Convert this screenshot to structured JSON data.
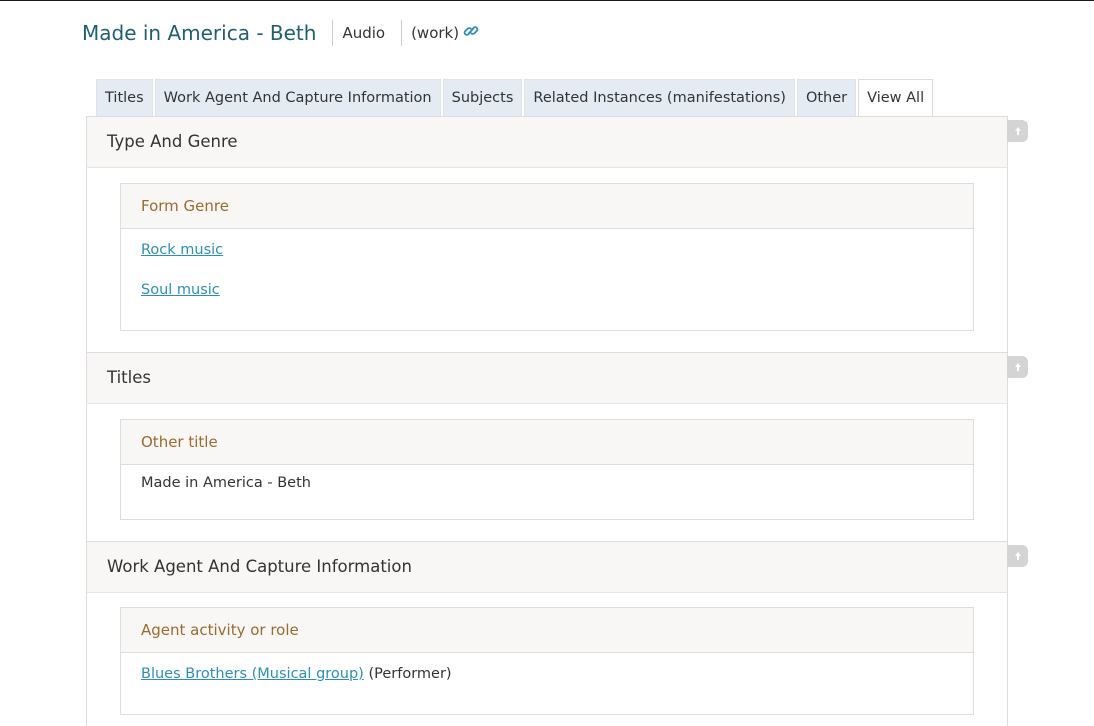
{
  "header": {
    "title": "Made in America - Beth",
    "type": "Audio",
    "kind": "(work)",
    "link_icon": "link-icon"
  },
  "tabs": [
    {
      "label": "Titles"
    },
    {
      "label": "Work Agent And Capture Information"
    },
    {
      "label": "Subjects"
    },
    {
      "label": "Related Instances (manifestations)"
    },
    {
      "label": "Other"
    },
    {
      "label": "View All",
      "active": true
    }
  ],
  "sections": [
    {
      "title": "Type And Genre",
      "subpanel": {
        "title": "Form Genre",
        "items": [
          {
            "link": "Rock music"
          },
          {
            "link": "Soul music"
          }
        ]
      }
    },
    {
      "title": "Titles",
      "subpanel": {
        "title": "Other title",
        "items": [
          {
            "text": "Made in America - Beth"
          }
        ]
      }
    },
    {
      "title": "Work Agent And Capture Information",
      "subpanel": {
        "title": "Agent activity or role",
        "items": [
          {
            "link": "Blues Brothers (Musical group)",
            "suffix": "(Performer)"
          }
        ]
      }
    }
  ],
  "icons": {
    "scroll_top": "arrow-up-icon"
  },
  "colors": {
    "title": "#1f5f74",
    "link": "#2b8fb5",
    "subpanel_title": "#9a6b2e",
    "tab_bg": "#e4ebf2",
    "section_bg": "#f8f7f5"
  }
}
